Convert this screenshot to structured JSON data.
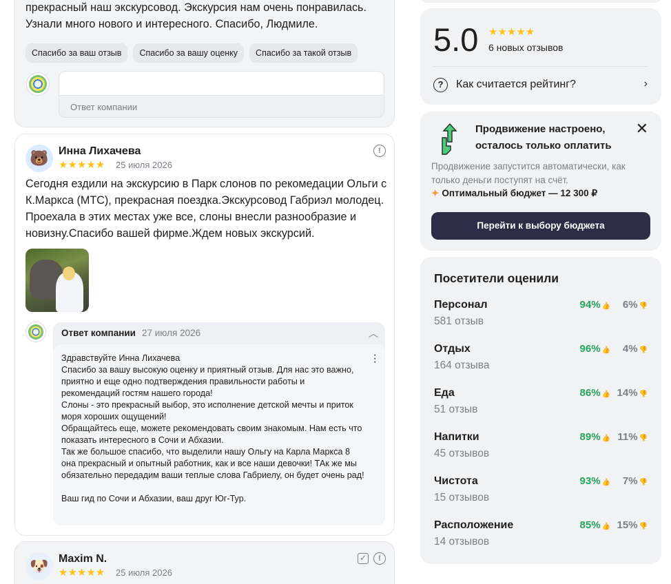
{
  "top_review": {
    "text_line1": "прекрасный наш экскурсовод. Экскурсия нам очень понравилась.",
    "text_line2": "Узнали много нового и интересного. Спасибо, Людмиле.",
    "chips": [
      "Спасибо за ваш отзыв",
      "Спасибо за вашу оценку",
      "Спасибо за такой отзыв"
    ],
    "reply_placeholder": "Ответ компании"
  },
  "review": {
    "avatar_emoji": "🐻",
    "author": "Инна Лихачева",
    "stars": "★★★★★",
    "date": "25 июля 2026",
    "text": "Сегодня ездили на экскурсию в Парк слонов по рекомедации Ольги с К.Маркса (МТС), прекрасная поездка.Экскурсовод Габриэл молодец. Проехала в этих местах уже все, слоны внесли разнообразие и новизну.Спасибо вашей фирме.Ждем новых экскурсий.",
    "company_answer": {
      "title": "Ответ компании",
      "date": "27 июля 2026",
      "text": "Здравствуйте Инна Лихачева\nСпасибо за вашу высокую оценку и приятный отзыв. Для нас это важно, приятно и еще одно подтверждения правильности работы и рекомендаций гостям нашего города!\nСлоны - это прекрасный выбор, это исполнение детской мечты и приток моря хороших ощущений!\nОбращайтесь еще, можете рекомендовать своим знакомым. Нам есть что показать интересного в Сочи и Абхазии.\nТак же большое спасибо, что выделили нашу Ольгу на Карла Маркса 8 она прекрасный и опытный работник, как и все наши девочки! ТАк же мы обязательно передадим ваши теплые слова Габриелу, он будет очень рад!\n\nВаш гид по Сочи и Абхазии, ваш друг Юг-Тур."
    }
  },
  "next_review": {
    "avatar_emoji": "🐶",
    "author": "Maxim N.",
    "stars": "★★★★★",
    "date": "25 июля 2026"
  },
  "rating": {
    "score": "5.0",
    "stars": "★★★★★",
    "count_label": "6 новых отзывов",
    "how_label": "Как считается рейтинг?"
  },
  "promo": {
    "title": "Продвижение настроено, осталось только оплатить",
    "description": "Продвижение запустится автоматически, как только деньги поступят на счёт.",
    "budget": "Оптимальный бюджет — 12 300 ₽",
    "button": "Перейти к выбору бюджета"
  },
  "visitors": {
    "title": "Посетители оценили",
    "rows": [
      {
        "name": "Персонал",
        "count": "581 отзыв",
        "pos": "94%",
        "neg": "6%"
      },
      {
        "name": "Отдых",
        "count": "164 отзыва",
        "pos": "96%",
        "neg": "4%"
      },
      {
        "name": "Еда",
        "count": "51 отзыв",
        "pos": "86%",
        "neg": "14%"
      },
      {
        "name": "Напитки",
        "count": "45 отзывов",
        "pos": "89%",
        "neg": "11%"
      },
      {
        "name": "Чистота",
        "count": "15 отзывов",
        "pos": "93%",
        "neg": "7%"
      },
      {
        "name": "Расположение",
        "count": "14 отзывов",
        "pos": "85%",
        "neg": "15%"
      }
    ]
  },
  "colors": {
    "positive": "#27a35a",
    "muted": "#7b8088",
    "star": "#fcc21b",
    "button_bg": "#2d2d48",
    "panel_bg": "#f1f2f4"
  }
}
